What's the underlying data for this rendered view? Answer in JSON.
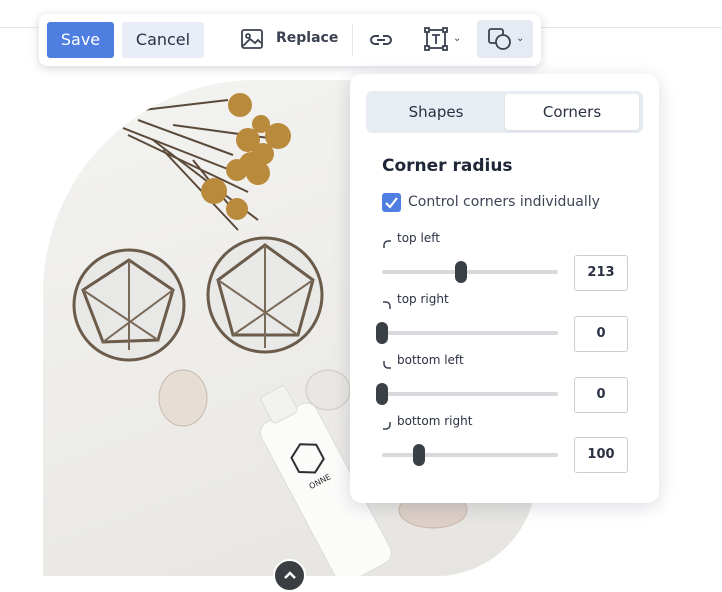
{
  "toolbar": {
    "save_label": "Save",
    "cancel_label": "Cancel",
    "replace_label": "Replace",
    "icons": [
      "image-icon",
      "link-icon",
      "text-frame-icon",
      "shapes-icon"
    ]
  },
  "panel": {
    "tabs": [
      {
        "label": "Shapes",
        "active": false
      },
      {
        "label": "Corners",
        "active": true
      }
    ],
    "title": "Corner radius",
    "individual_checkbox": {
      "label": "Control corners individually",
      "checked": true
    },
    "corners": [
      {
        "label": "top left",
        "value": "213"
      },
      {
        "label": "top right",
        "value": "0"
      },
      {
        "label": "bottom left",
        "value": "0"
      },
      {
        "label": "bottom right",
        "value": "100"
      }
    ]
  },
  "colors": {
    "accent": "#4d7ee0",
    "tab_bg": "#e8ecf3",
    "slider_thumb": "#3b3f46",
    "bottle_mark": "ONNE"
  }
}
